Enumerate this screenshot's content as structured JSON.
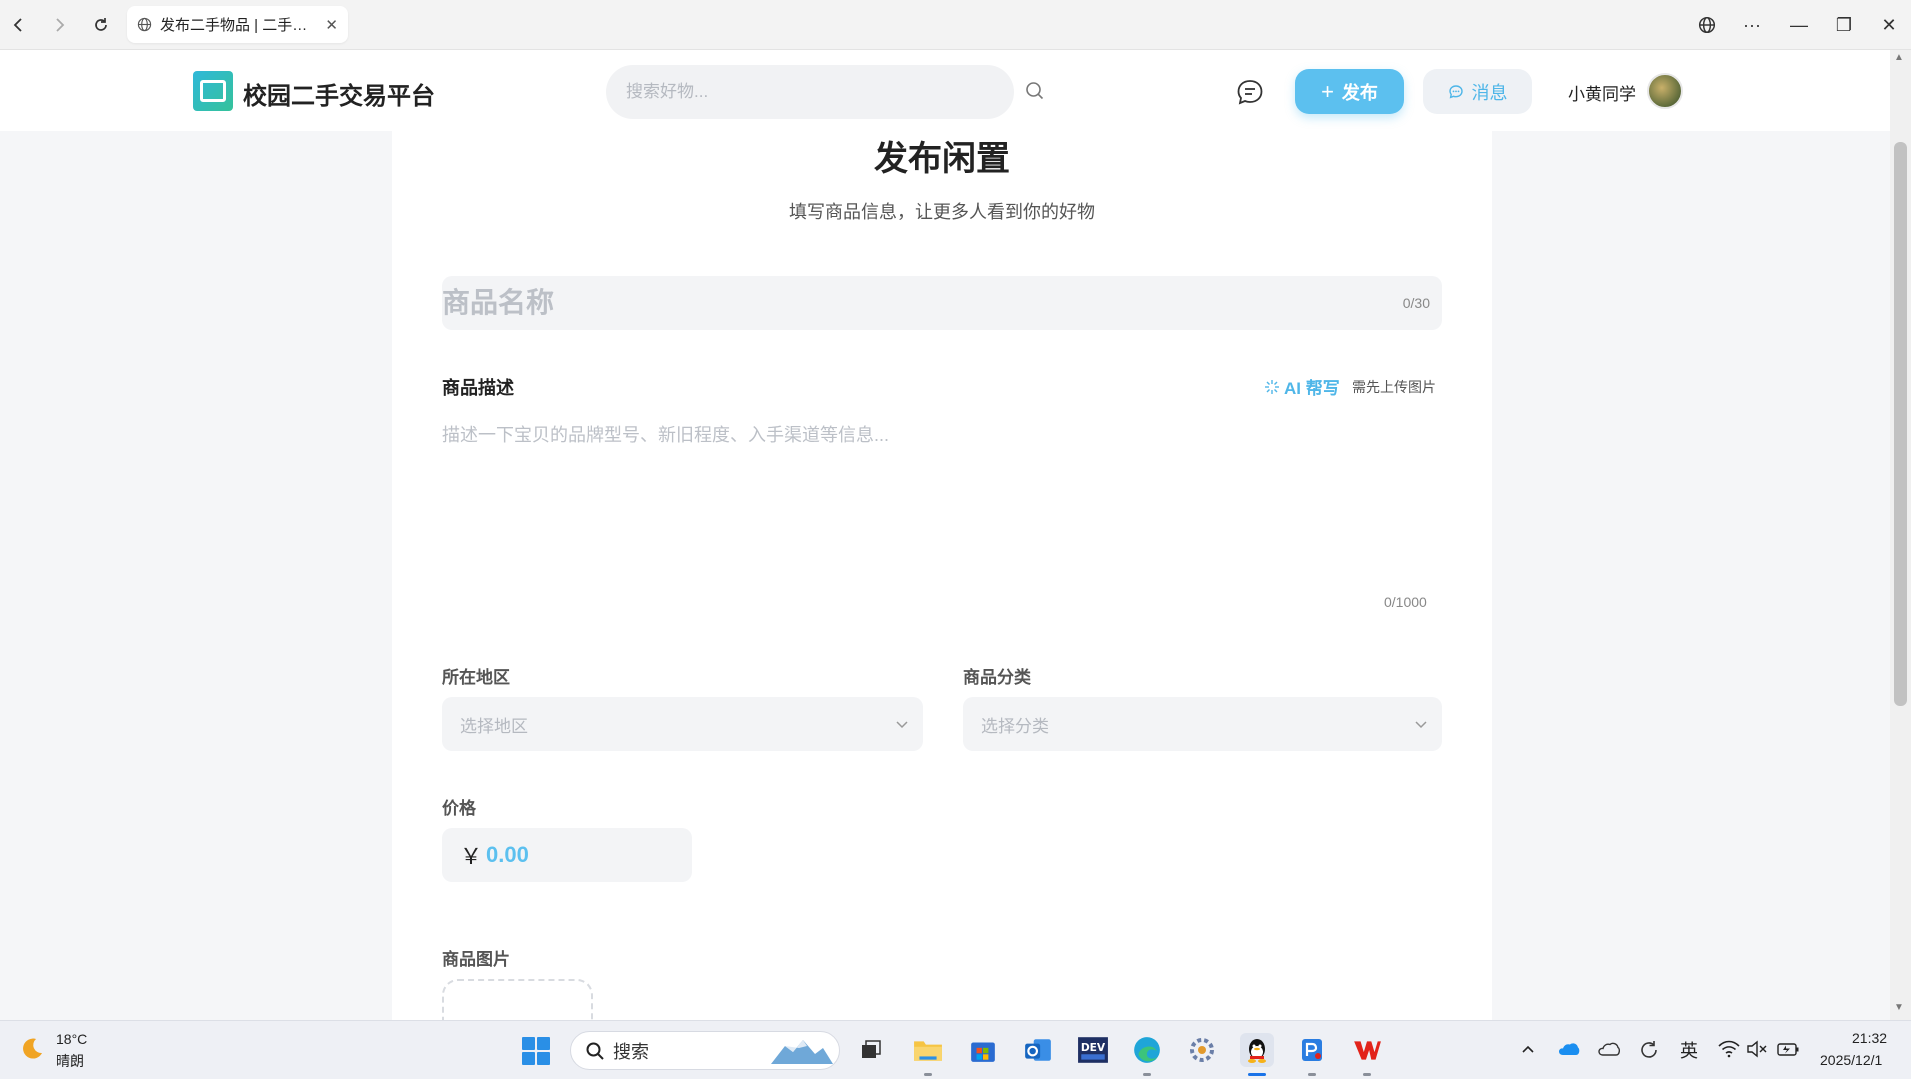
{
  "browser": {
    "tab_title": "发布二手物品 | 二手…",
    "tab_close": "✕",
    "back_glyph": "‹",
    "forward_glyph": "›",
    "reload_glyph": "↻",
    "more_glyph": "···",
    "minimize_glyph": "—",
    "restore_glyph": "❐",
    "close_glyph": "✕"
  },
  "header": {
    "site_name": "校园二手交易平台",
    "search_placeholder": "搜索好物...",
    "publish_label": "发布",
    "publish_icon": "+",
    "messages_label": "消息",
    "username": "小黄同学"
  },
  "form": {
    "title": "发布闲置",
    "subtitle": "填写商品信息，让更多人看到你的好物",
    "name_placeholder": "商品名称",
    "name_count": "0/30",
    "description_label": "商品描述",
    "ai_help_label": "AI 帮写",
    "ai_help_hint": "需先上传图片",
    "description_placeholder": "描述一下宝贝的品牌型号、新旧程度、入手渠道等信息...",
    "description_count": "0/1000",
    "region_label": "所在地区",
    "region_placeholder": "选择地区",
    "category_label": "商品分类",
    "category_placeholder": "选择分类",
    "price_label": "价格",
    "currency_symbol": "￥",
    "price_placeholder": "0.00",
    "images_label": "商品图片"
  },
  "taskbar": {
    "weather_temp": "18°C",
    "weather_desc": "晴朗",
    "search_label": "搜索",
    "ime_label": "英",
    "time": "21:32",
    "date": "2025/12/1"
  },
  "colors": {
    "accent": "#5cc0ef",
    "accent_text": "#4fb6e8",
    "input_bg": "#f3f4f6",
    "page_bg": "#f5f6f8"
  }
}
